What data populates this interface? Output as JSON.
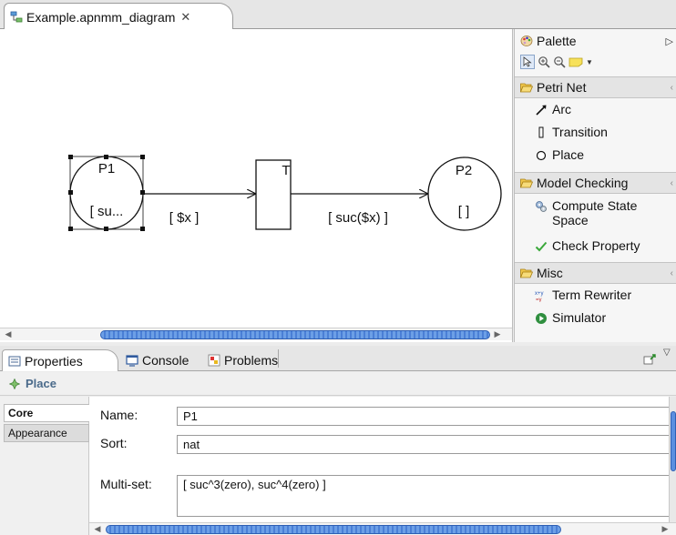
{
  "editor": {
    "tab_label": "Example.apnmm_diagram",
    "close_glyph": "✕"
  },
  "diagram": {
    "place1": {
      "name": "P1",
      "marking": "[ su..."
    },
    "transition": {
      "name": "T"
    },
    "place2": {
      "name": "P2",
      "marking": "[ ]"
    },
    "arc1_label": "[ $x ]",
    "arc2_label": "[ suc($x) ]"
  },
  "palette": {
    "title": "Palette",
    "drawers": [
      {
        "label": "Petri Net",
        "items": [
          "Arc",
          "Transition",
          "Place"
        ]
      },
      {
        "label": "Model Checking",
        "items": [
          "Compute State Space",
          "Check Property"
        ]
      },
      {
        "label": "Misc",
        "items": [
          "Term Rewriter",
          "Simulator"
        ]
      }
    ],
    "state_space_line1": "Compute State",
    "state_space_line2": "Space"
  },
  "views": {
    "tabs": [
      "Properties",
      "Console",
      "Problems"
    ]
  },
  "properties": {
    "section_title": "Place",
    "side_tabs": [
      "Core",
      "Appearance"
    ],
    "name_label": "Name:",
    "name_value": "P1",
    "sort_label": "Sort:",
    "sort_value": "nat",
    "multiset_label": "Multi-set:",
    "multiset_value": "[ suc^3(zero), suc^4(zero) ]"
  },
  "colors": {
    "scroll_thumb": "#5b8fe0",
    "section_title": "#4a6a8a",
    "check_green": "#3aa83a"
  }
}
